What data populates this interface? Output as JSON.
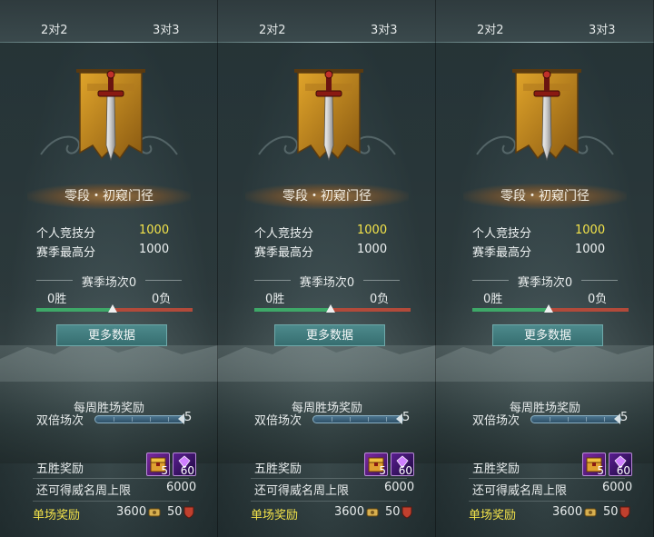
{
  "panels": [
    {
      "tabs": {
        "left": "2对2",
        "right": "3对3"
      },
      "rank": "零段・初窥门径",
      "stats": [
        {
          "label": "个人竞技分",
          "value": "1000",
          "highlight": true
        },
        {
          "label": "赛季最高分",
          "value": "1000",
          "highlight": false
        }
      ],
      "season": {
        "title": "赛季场次0",
        "wins": "0胜",
        "losses": "0负",
        "win_fraction": 0.49
      },
      "more_button": "更多数据",
      "weekly": {
        "title": "每周胜场奖励",
        "double_label": "双倍场次",
        "double_max": "5",
        "progress": 1.0
      },
      "five_win": {
        "label": "五胜奖励",
        "items": [
          {
            "count": "5",
            "icon": "treasure-chest-icon"
          },
          {
            "count": "60",
            "icon": "purple-gem-icon"
          }
        ]
      },
      "fame": {
        "label": "还可得威名周上限",
        "value": "6000"
      },
      "single": {
        "label": "单场奖励",
        "coin_value": "3600",
        "shield_value": "50"
      }
    },
    {
      "tabs": {
        "left": "2对2",
        "right": "3对3"
      },
      "rank": "零段・初窥门径",
      "stats": [
        {
          "label": "个人竞技分",
          "value": "1000",
          "highlight": true
        },
        {
          "label": "赛季最高分",
          "value": "1000",
          "highlight": false
        }
      ],
      "season": {
        "title": "赛季场次0",
        "wins": "0胜",
        "losses": "0负",
        "win_fraction": 0.49
      },
      "more_button": "更多数据",
      "weekly": {
        "title": "每周胜场奖励",
        "double_label": "双倍场次",
        "double_max": "5",
        "progress": 1.0
      },
      "five_win": {
        "label": "五胜奖励",
        "items": [
          {
            "count": "5",
            "icon": "treasure-chest-icon"
          },
          {
            "count": "60",
            "icon": "purple-gem-icon"
          }
        ]
      },
      "fame": {
        "label": "还可得威名周上限",
        "value": "6000"
      },
      "single": {
        "label": "单场奖励",
        "coin_value": "3600",
        "shield_value": "50"
      }
    },
    {
      "tabs": {
        "left": "2对2",
        "right": "3对3"
      },
      "rank": "零段・初窥门径",
      "stats": [
        {
          "label": "个人竞技分",
          "value": "1000",
          "highlight": true
        },
        {
          "label": "赛季最高分",
          "value": "1000",
          "highlight": false
        }
      ],
      "season": {
        "title": "赛季场次0",
        "wins": "0胜",
        "losses": "0负",
        "win_fraction": 0.49
      },
      "more_button": "更多数据",
      "weekly": {
        "title": "每周胜场奖励",
        "double_label": "双倍场次",
        "double_max": "5",
        "progress": 1.0
      },
      "five_win": {
        "label": "五胜奖励",
        "items": [
          {
            "count": "5",
            "icon": "treasure-chest-icon"
          },
          {
            "count": "60",
            "icon": "purple-gem-icon"
          }
        ]
      },
      "fame": {
        "label": "还可得威名周上限",
        "value": "6000"
      },
      "single": {
        "label": "单场奖励",
        "coin_value": "3600",
        "shield_value": "50"
      }
    }
  ],
  "colors": {
    "highlight": "#f4e44a",
    "win_bar": "#3ea868",
    "loss_bar": "#b24a3a",
    "button": "#4d8a8c"
  }
}
